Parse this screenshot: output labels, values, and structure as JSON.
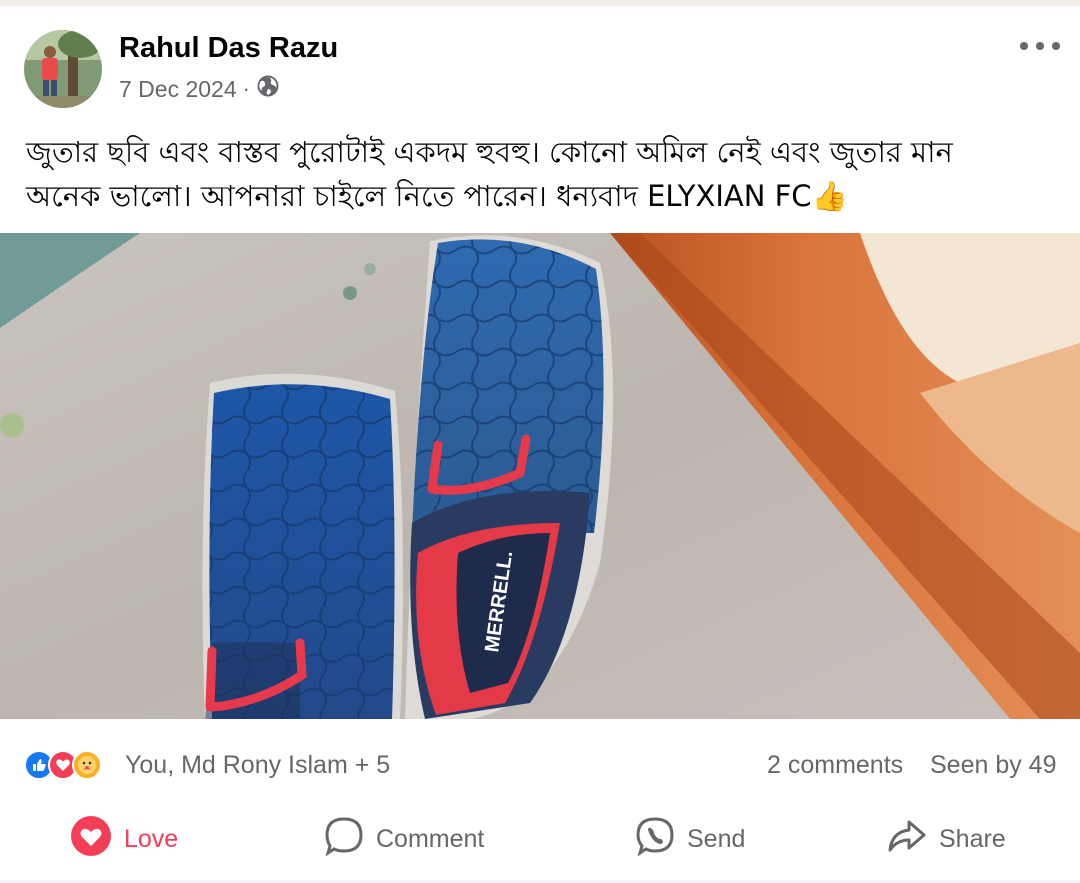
{
  "post": {
    "author_name": "Rahul Das Razu",
    "date": "7 Dec 2024",
    "separator": "·",
    "audience_icon": "globe-icon",
    "more_icon": "more-horizontal-icon",
    "text_line1": "জুতার ছবি এবং বাস্তব পুরোটাই একদম হুবহু। কোনো অমিল নেই এবং জুতার মান",
    "text_line2": "অনেক ভালো। আপনারা চাইলে নিতে পারেন। ধন্যবাদ ELYXIAN FC👍",
    "photo": {
      "brand_text": "MERRELL."
    }
  },
  "stats": {
    "reaction_icons": [
      "like-icon",
      "love-icon",
      "care-icon"
    ],
    "reaction_names": "You, Md Rony Islam + 5",
    "comments": "2 comments",
    "seen_by": "Seen by 49"
  },
  "actions": {
    "love": {
      "label": "Love",
      "icon": "heart-filled-icon",
      "color": "#f33e58"
    },
    "comment": {
      "label": "Comment",
      "icon": "comment-bubble-icon"
    },
    "send": {
      "label": "Send",
      "icon": "messenger-icon"
    },
    "share": {
      "label": "Share",
      "icon": "share-arrow-icon"
    }
  },
  "colors": {
    "primary_text": "#050505",
    "secondary_text": "#65676b",
    "like_blue": "#1877f2",
    "love_red": "#f33e58"
  }
}
